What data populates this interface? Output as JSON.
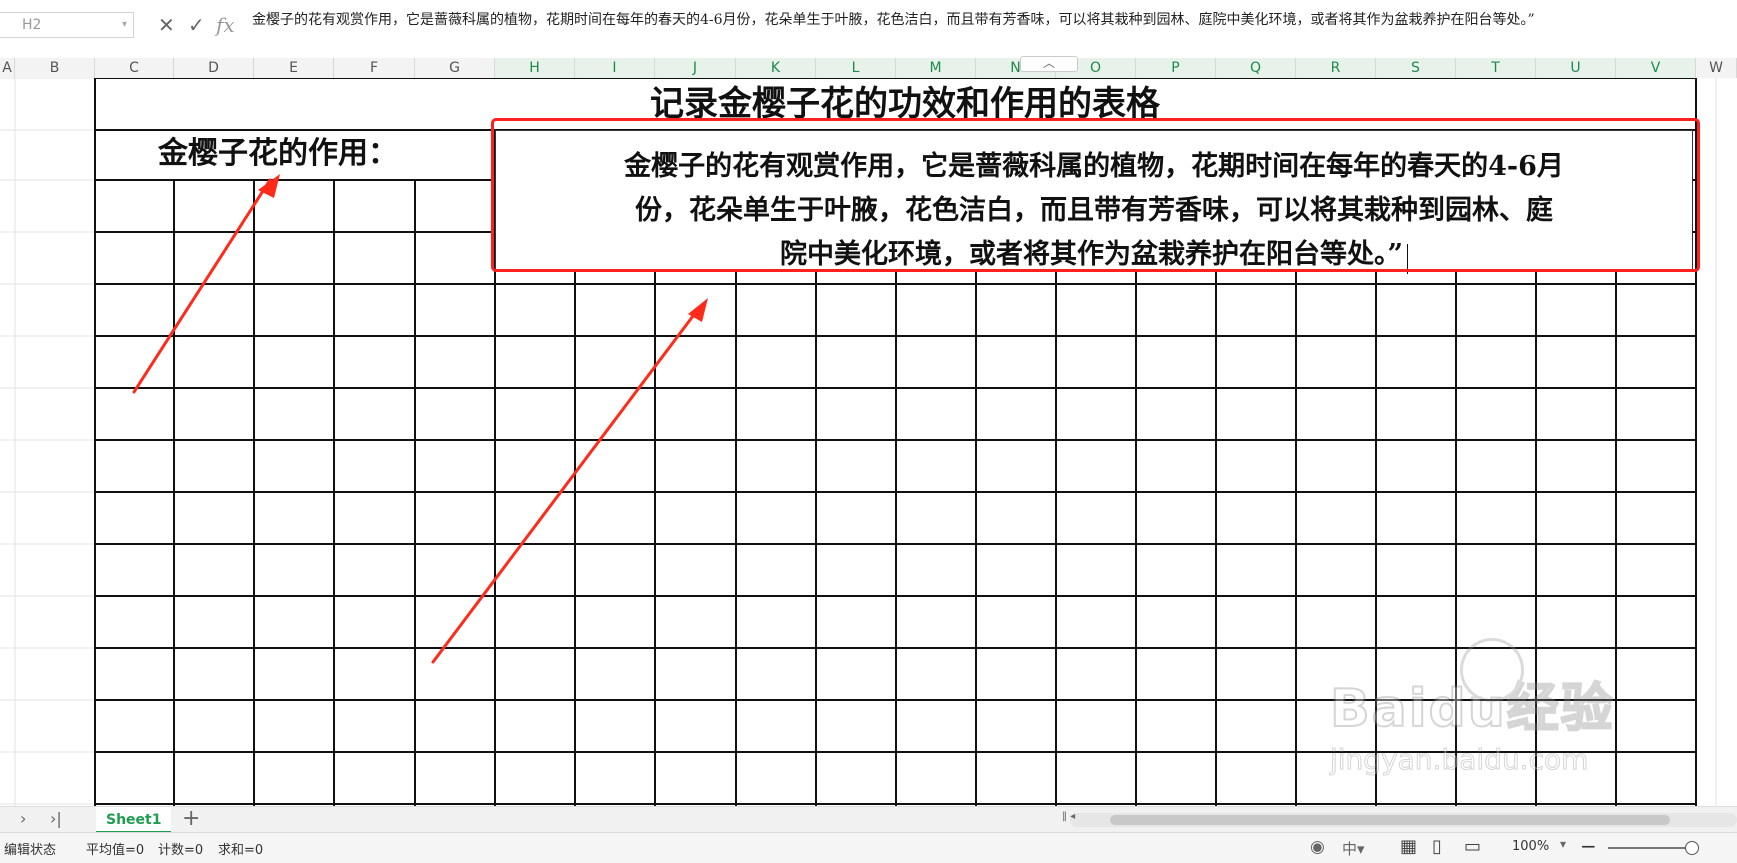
{
  "formula_bar": {
    "cell_ref": "H2",
    "formula_text": "金樱子的花有观赏作用，它是蔷薇科属的植物，花期时间在每年的春天的4-6月份，花朵单生于叶腋，花色洁白，而且带有芳香味，可以将其栽种到园林、庭院中美化环境，或者将其作为盆栽养护在阳台等处。”",
    "cancel_icon": "close-icon",
    "confirm_icon": "check-icon",
    "fx_label": "fx"
  },
  "columns": [
    "A",
    "B",
    "C",
    "D",
    "E",
    "F",
    "G",
    "H",
    "I",
    "J",
    "K",
    "L",
    "M",
    "N",
    "O",
    "P",
    "Q",
    "R",
    "S",
    "T",
    "U",
    "V",
    "W"
  ],
  "selected_columns": [
    "H",
    "I",
    "J",
    "K",
    "L",
    "M",
    "N",
    "O",
    "P",
    "Q",
    "R",
    "S",
    "T",
    "U",
    "V"
  ],
  "sheet": {
    "table_title": "记录金樱子花的功效和作用的表格",
    "label_cell": "金樱子花的作用：",
    "content_cell_lines": [
      "金樱子的花有观赏作用，它是蔷薇科属的植物，花期时间在每年的春天的4-6月",
      "份，花朵单生于叶腋，花色洁白，而且带有芳香味，可以将其栽种到园林、庭",
      "院中美化环境，或者将其作为盆栽养护在阳台等处。”"
    ],
    "highlight_color": "#ff2020",
    "arrow_color": "#ff2a1a"
  },
  "tabs": {
    "sheet_name": "Sheet1",
    "add_icon": "plus-icon"
  },
  "status_bar": {
    "mode": "编辑状态",
    "average": "平均值=0",
    "count": "计数=0",
    "sum": "求和=0",
    "zoom": "100%",
    "input_method": "中"
  },
  "watermark": {
    "logo": "Baidu经验",
    "url": "jingyan.baidu.com"
  }
}
